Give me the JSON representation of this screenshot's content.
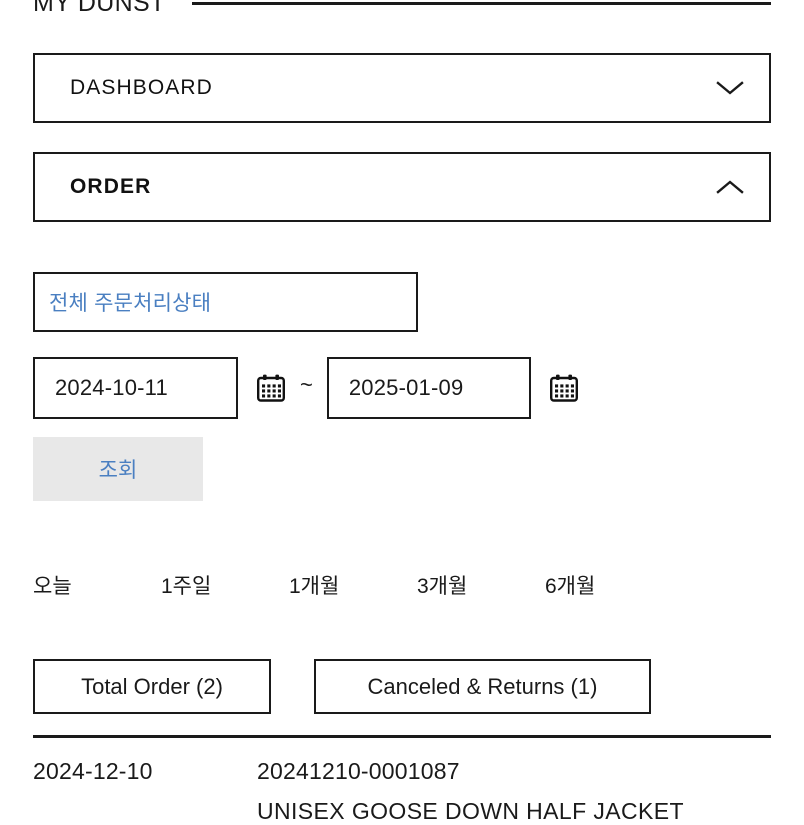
{
  "header": {
    "title": "MY DUNST"
  },
  "nav": {
    "items": [
      {
        "label": "DASHBOARD",
        "state": "collapsed",
        "icon": "chevron-down-icon"
      },
      {
        "label": "ORDER",
        "state": "expanded",
        "icon": "chevron-up-icon"
      }
    ]
  },
  "filters": {
    "status_select": {
      "selected": "전체 주문처리상태",
      "color": "#4a7fc1"
    },
    "date_range": {
      "start": "2024-10-11",
      "end": "2025-01-09",
      "separator": "~",
      "start_icon": "calendar-icon",
      "end_icon": "calendar-icon"
    },
    "search_button": {
      "label": "조회",
      "background": "#e8e8e8",
      "text_color": "#4a7fc1"
    },
    "quick_ranges": [
      {
        "label": "오늘"
      },
      {
        "label": "1주일"
      },
      {
        "label": "1개월"
      },
      {
        "label": "3개월"
      },
      {
        "label": "6개월"
      }
    ]
  },
  "tabs": [
    {
      "label": "Total Order (2)"
    },
    {
      "label": "Canceled & Returns (1)"
    }
  ],
  "orders": [
    {
      "date": "2024-12-10",
      "number": "20241210-0001087",
      "product": "UNISEX GOOSE DOWN HALF JACKET"
    }
  ]
}
